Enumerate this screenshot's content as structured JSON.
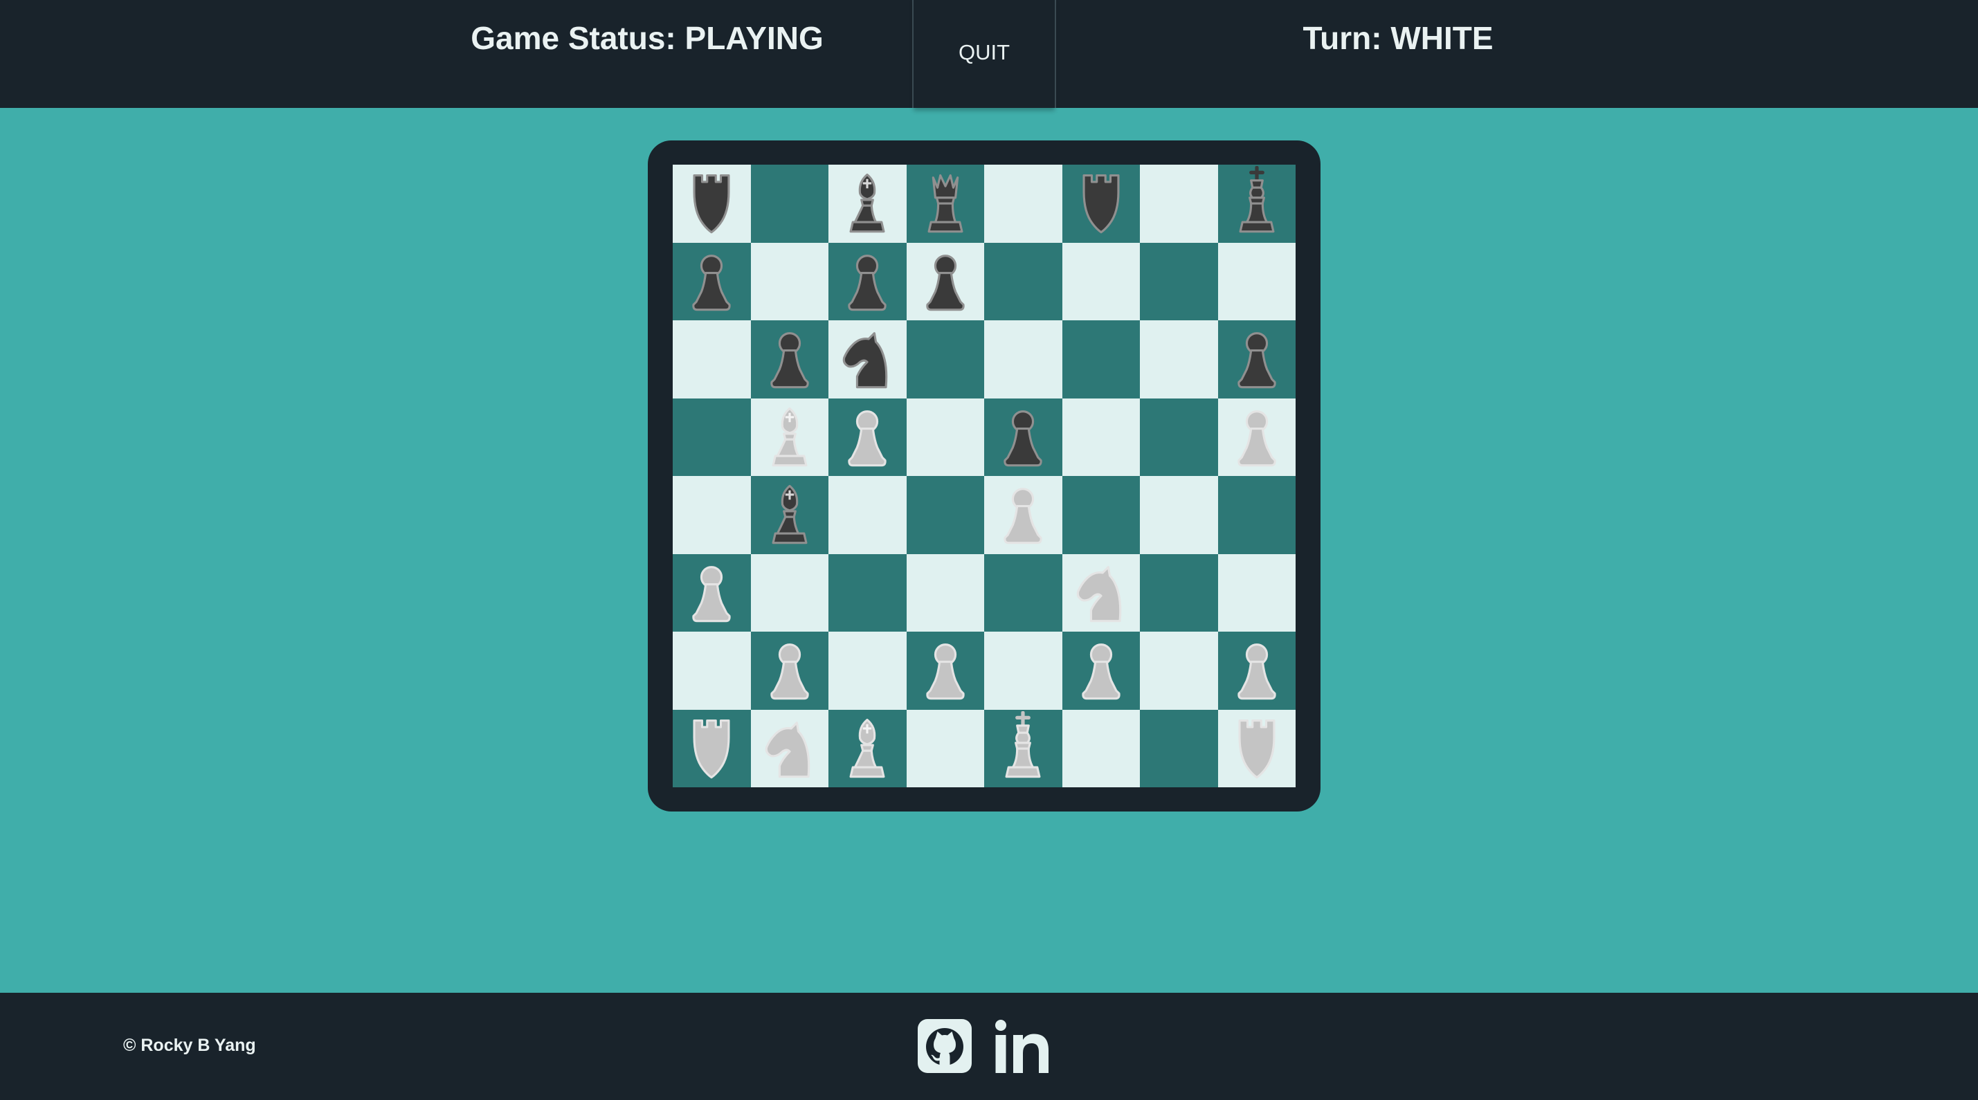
{
  "header": {
    "status_label": "Game Status: PLAYING",
    "quit_label": "QUIT",
    "turn_label": "Turn: WHITE"
  },
  "footer": {
    "copyright": "© Rocky B Yang",
    "links": [
      {
        "icon": "github-icon"
      },
      {
        "icon": "linkedin-icon"
      }
    ]
  },
  "colors": {
    "page_background": "#40aeaa",
    "bar_background": "#19232b",
    "light_square": "#e0f1f0",
    "dark_square": "#2d7876",
    "black_piece": "#3a3a3a",
    "white_piece": "#c4c4c4"
  },
  "board": {
    "ranks": [
      [
        "br",
        "",
        "bb",
        "bq",
        "",
        "br",
        "",
        "bk"
      ],
      [
        "bp",
        "",
        "bp",
        "bp",
        "",
        "",
        "",
        ""
      ],
      [
        "",
        "bp",
        "bn",
        "",
        "",
        "",
        "",
        "bp"
      ],
      [
        "",
        "wb",
        "wp",
        "",
        "bp",
        "",
        "",
        "wp"
      ],
      [
        "",
        "bb",
        "",
        "",
        "wp",
        "",
        "",
        ""
      ],
      [
        "wp",
        "",
        "",
        "",
        "",
        "wn",
        "",
        ""
      ],
      [
        "",
        "wp",
        "",
        "wp",
        "",
        "wp",
        "",
        "wp"
      ],
      [
        "wr",
        "wn",
        "wb",
        "",
        "wk",
        "",
        "",
        "wr"
      ]
    ]
  }
}
